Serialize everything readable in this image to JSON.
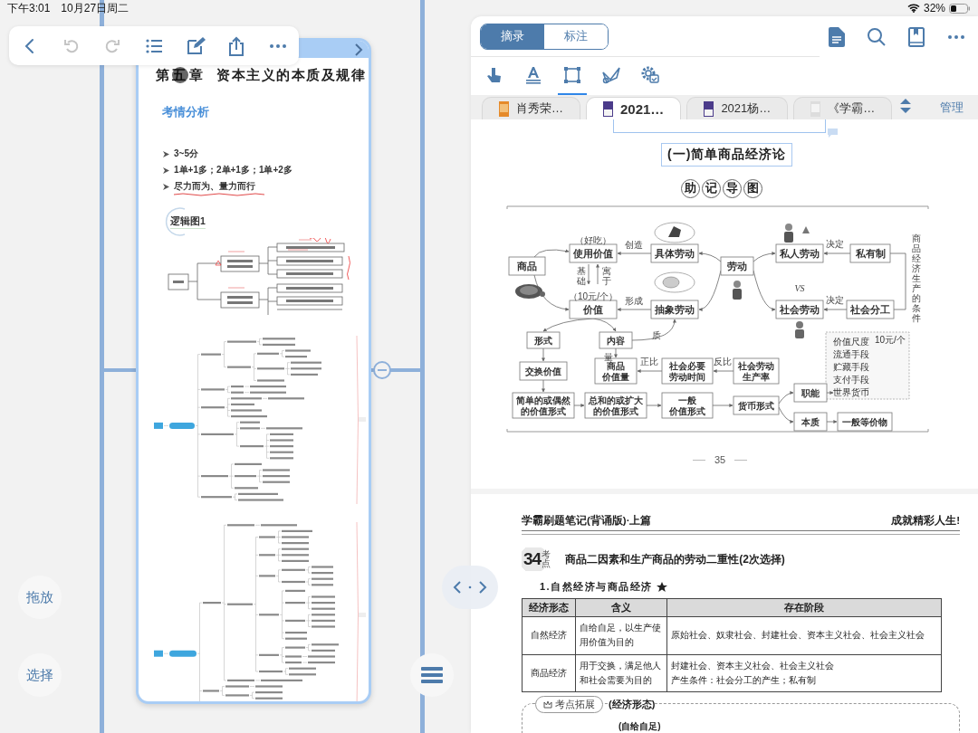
{
  "status_bar": {
    "time": "下午3:01",
    "date": "10月27日周二",
    "battery": "32%"
  },
  "toolbar": [
    {
      "kind": "back",
      "disabled": false
    },
    {
      "kind": "undo",
      "disabled": true
    },
    {
      "kind": "redo",
      "disabled": true
    },
    {
      "kind": "outline",
      "disabled": false
    },
    {
      "kind": "edit",
      "disabled": false
    },
    {
      "kind": "share",
      "disabled": false
    },
    {
      "kind": "more",
      "disabled": false
    }
  ],
  "note_page": {
    "chapter": {
      "prefix": "第",
      "number": "五",
      "suffix": "章",
      "title": "资本主义的本质及规律"
    },
    "section": "考情分析",
    "bullets": [
      {
        "text": "3~5分",
        "underlined": false
      },
      {
        "text": "1单+1多；2单+1多；1单+2多",
        "underlined": false
      },
      {
        "text": "尽力而为、量力而行",
        "underlined": true
      }
    ],
    "diagram_caption": "逻辑图1"
  },
  "left_buttons": [
    "拖放",
    "选择"
  ],
  "reader": {
    "modes": [
      {
        "label": "摘录",
        "selected": true
      },
      {
        "label": "标注",
        "selected": false
      }
    ],
    "tools": [
      {
        "kind": "hand",
        "selected": false
      },
      {
        "kind": "text",
        "selected": false
      },
      {
        "kind": "rect",
        "selected": true
      },
      {
        "kind": "lasso",
        "selected": false
      },
      {
        "kind": "settings",
        "selected": false
      }
    ],
    "tabs": [
      {
        "label": "肖秀荣…",
        "kind": "orange",
        "selected": false
      },
      {
        "label": "2021…",
        "kind": "purple",
        "selected": true
      },
      {
        "label": "2021杨…",
        "kind": "purple",
        "selected": false
      },
      {
        "label": "《学霸…",
        "kind": "document",
        "selected": false
      }
    ],
    "manage": "管理"
  },
  "document": {
    "section_title": "(一)简单商品经济论",
    "mnemonic_title": [
      "助",
      "记",
      "导",
      "图"
    ],
    "diagram": {
      "nodes": [
        {
          "lines": [
            "商品"
          ]
        },
        {
          "lines": [
            "使用价值"
          ]
        },
        {
          "lines": [
            "价值"
          ]
        },
        {
          "lines": [
            "具体劳动"
          ]
        },
        {
          "lines": [
            "抽象劳动"
          ]
        },
        {
          "lines": [
            "劳动"
          ]
        },
        {
          "lines": [
            "私人劳动"
          ]
        },
        {
          "lines": [
            "社会劳动"
          ]
        },
        {
          "lines": [
            "私有制"
          ]
        },
        {
          "lines": [
            "社会分工"
          ]
        },
        {
          "lines": [
            "形式"
          ]
        },
        {
          "lines": [
            "内容"
          ]
        },
        {
          "lines": [
            "交换价值"
          ]
        },
        {
          "lines": [
            "商品",
            "价值量"
          ]
        },
        {
          "lines": [
            "社会必要",
            "劳动时间"
          ]
        },
        {
          "lines": [
            "社会劳动",
            "生产率"
          ]
        },
        {
          "lines": [
            "简单的或偶然",
            "的价值形式"
          ]
        },
        {
          "lines": [
            "总和的或扩大",
            "的价值形式"
          ]
        },
        {
          "lines": [
            "一般",
            "价值形式"
          ]
        },
        {
          "lines": [
            "货币形式"
          ]
        },
        {
          "lines": [
            "职能"
          ]
        },
        {
          "lines": [
            "本质"
          ]
        },
        {
          "lines": [
            "一般等价物"
          ]
        }
      ],
      "labels": [
        "（好吃）",
        "创造",
        "基础",
        "寓于",
        "（10元/个）",
        "形成",
        "质",
        "量",
        "正比",
        "反比",
        "决定",
        "决定",
        "VS",
        "商品经济生产的条件"
      ],
      "functions": [
        "价值尺度",
        "流通手段",
        "贮藏手段",
        "支付手段",
        "世界货币"
      ],
      "price_tag": "10元/个"
    },
    "page_number": "35",
    "header_left": "学霸刷题笔记(背诵版)·上篇",
    "header_right": "成就精彩人生!",
    "point_number": "34",
    "point_tag": "考点",
    "point_title": "商品二因素和生产商品的劳动二重性(2次选择)",
    "subsection": "1.自然经济与商品经济",
    "table": {
      "columns": [
        "经济形态",
        "含义",
        "存在阶段"
      ],
      "rows": [
        [
          [
            "自然经济"
          ],
          [
            "自给自足，以生产使用价值为目的"
          ],
          [
            "原始社会、奴隶社会、封建社会、资本主义社会、社会主义社会"
          ]
        ],
        [
          [
            "商品经济"
          ],
          [
            "用于交换，满足他人和社会需要为目的"
          ],
          [
            "封建社会、资本主义社会、社会主义社会",
            "产生条件：社会分工的产生；私有制"
          ]
        ]
      ]
    },
    "extension_tag": "考点拓展",
    "extension_title": "(经济形态)",
    "extension_sub": "(自给自足)"
  }
}
